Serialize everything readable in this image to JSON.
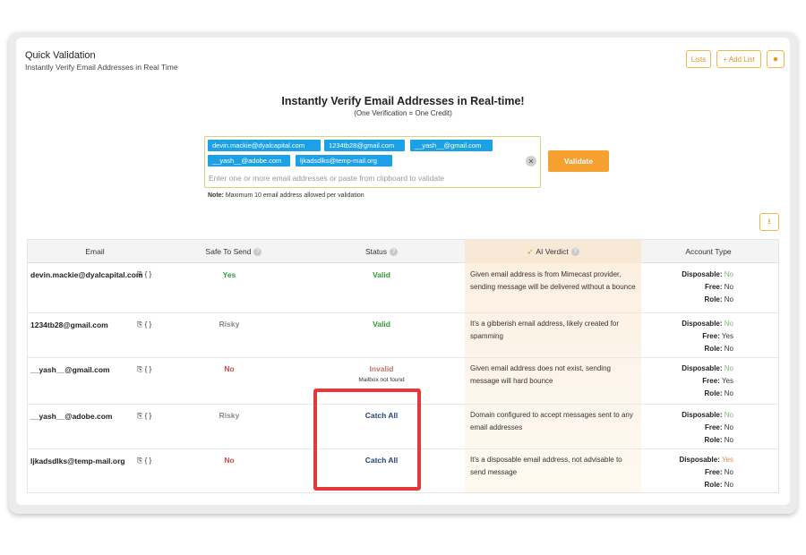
{
  "header": {
    "title": "Quick Validation",
    "subtitle": "Instantly Verify Email Addresses in Real Time",
    "lists_btn": "Lists",
    "add_list_btn": "+ Add List",
    "settings_icon": "gear-icon"
  },
  "main": {
    "title": "Instantly Verify Email Addresses in Real-time!",
    "subtitle": "(One Verification = One Credit)",
    "chips": [
      "devin.mackie@dyalcapital.com",
      "1234tb28@gmail.com",
      "__yash__@gmail.com",
      "__yash__@adobe.com",
      "ljkadsdlks@temp-mail.org"
    ],
    "placeholder": "Enter one or more email addresses or paste from clipboard to validate",
    "clear_icon": "✕",
    "validate_btn": "Validate",
    "note_label": "Note:",
    "note_text": " Maximum 10 email address allowed per validation",
    "download_icon": "download-icon"
  },
  "table": {
    "headers": {
      "email": "Email",
      "safe": "Safe To Send",
      "status": "Status",
      "verdict": "AI Verdict",
      "account": "Account Type"
    },
    "copy_icon": "⎘ { }",
    "rows": [
      {
        "email": "devin.mackie@dyalcapital.com",
        "safe": "Yes",
        "status": "Valid",
        "status_sub": "",
        "verdict": "Given email address is from Mimecast provider, sending message will be delivered without a bounce",
        "disposable": "No",
        "free": "No",
        "role": "No"
      },
      {
        "email": "1234tb28@gmail.com",
        "safe": "Risky",
        "status": "Valid",
        "status_sub": "",
        "verdict": "It's a gibberish email address, likely created for spamming",
        "disposable": "No",
        "free": "Yes",
        "role": "No"
      },
      {
        "email": "__yash__@gmail.com",
        "safe": "No",
        "status": "Invalid",
        "status_sub": "Mailbox not found",
        "verdict": "Given email address does not exist, sending message will hard bounce",
        "disposable": "No",
        "free": "Yes",
        "role": "No"
      },
      {
        "email": "__yash__@adobe.com",
        "safe": "Risky",
        "status": "Catch All",
        "status_sub": "",
        "verdict": "Domain configured to accept messages sent to any email addresses",
        "disposable": "No",
        "free": "No",
        "role": "No"
      },
      {
        "email": "ljkadsdlks@temp-mail.org",
        "safe": "No",
        "status": "Catch All",
        "status_sub": "",
        "verdict": "It's a disposable email address, not advisable to send message",
        "disposable": "Yes",
        "free": "No",
        "role": "No"
      }
    ],
    "labels": {
      "disposable": "Disposable:",
      "free": "Free:",
      "role": "Role:"
    }
  },
  "colors": {
    "accent": "#f5a02f",
    "chip": "#1da1e6",
    "highlight": "#e23a3a"
  }
}
